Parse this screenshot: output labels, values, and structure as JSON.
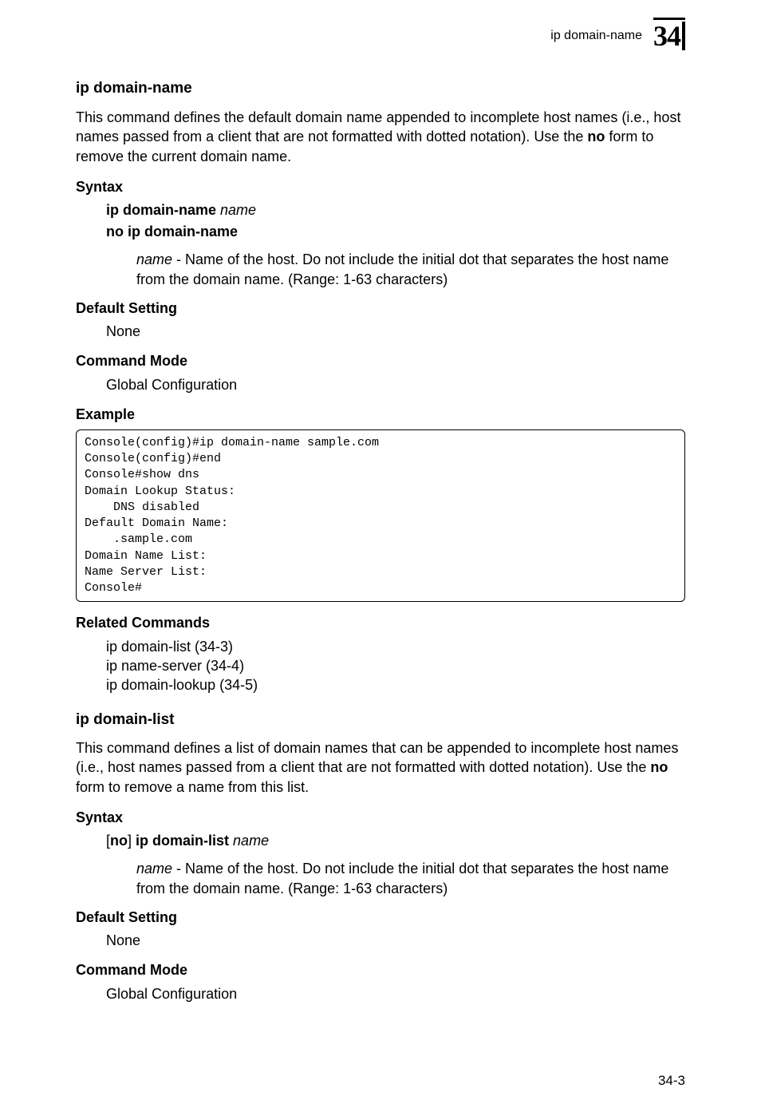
{
  "header": {
    "running": "ip domain-name",
    "chapter": "34"
  },
  "sec1": {
    "title": "ip domain-name",
    "desc_pre": "This command defines the default domain name appended to incomplete host names (i.e., host names passed from a client that are not formatted with dotted notation). Use the ",
    "desc_bold": "no",
    "desc_post": " form to remove the current domain name.",
    "syntax_label": "Syntax",
    "syntax_l1_b": "ip domain-name ",
    "syntax_l1_i": "name",
    "syntax_l2_b": "no ip domain-name",
    "param_i": "name",
    "param_rest": " - Name of the host. Do not include the initial dot that separates the host name from the domain name. (Range: 1-63 characters)",
    "default_label": "Default Setting",
    "default_value": "None",
    "mode_label": "Command Mode",
    "mode_value": "Global Configuration",
    "example_label": "Example",
    "code": "Console(config)#ip domain-name sample.com\nConsole(config)#end\nConsole#show dns\nDomain Lookup Status:\n    DNS disabled\nDefault Domain Name:\n    .sample.com\nDomain Name List:\nName Server List:\nConsole#",
    "related_label": "Related Commands",
    "related_1": "ip domain-list (34-3)",
    "related_2": "ip name-server (34-4)",
    "related_3": "ip domain-lookup (34-5)"
  },
  "sec2": {
    "title": "ip domain-list",
    "desc_pre": "This command defines a list of domain names that can be appended to incomplete host names (i.e., host names passed from a client that are not formatted with dotted notation). Use the ",
    "desc_bold": "no",
    "desc_post": " form to remove a name from this list.",
    "syntax_label": "Syntax",
    "syntax_pre": "[",
    "syntax_no": "no",
    "syntax_mid": "] ",
    "syntax_cmd": "ip domain-list ",
    "syntax_i": "name",
    "param_i": "name",
    "param_rest": " - Name of the host. Do not include the initial dot that separates the host name from the domain name. (Range: 1-63 characters)",
    "default_label": "Default Setting",
    "default_value": "None",
    "mode_label": "Command Mode",
    "mode_value": "Global Configuration"
  },
  "footer": {
    "page": "34-3"
  }
}
